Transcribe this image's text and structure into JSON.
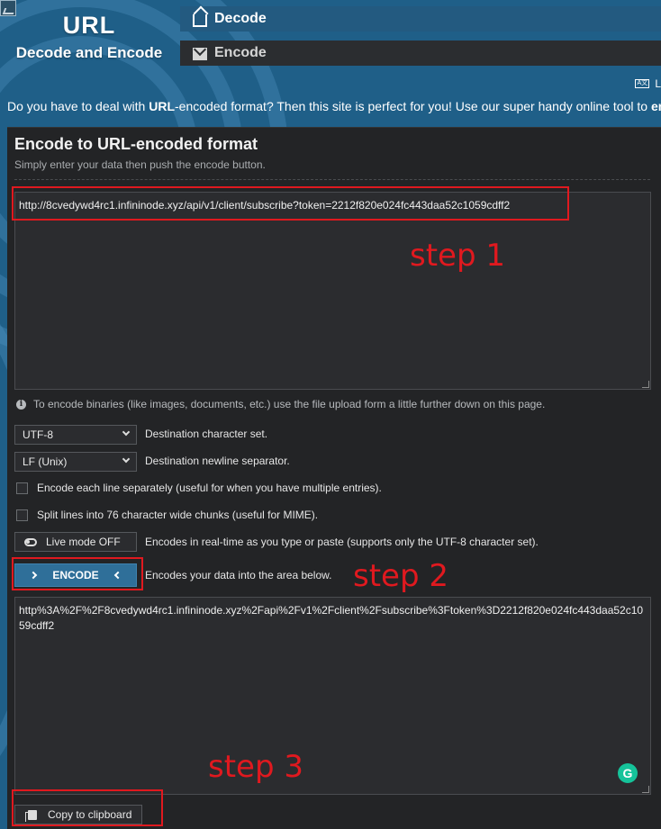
{
  "brand": {
    "title": "URL",
    "subtitle": "Decode and Encode"
  },
  "nav": {
    "decode": "Decode",
    "encode": "Encode"
  },
  "language": {
    "label": "L"
  },
  "intro": {
    "part1": "Do you have to deal with ",
    "bold1": "URL",
    "part2": "-encoded format? Then this site is perfect for you! Use our super handy online tool to ",
    "bold2": "en"
  },
  "panel": {
    "title": "Encode to URL-encoded format",
    "subtitle": "Simply enter your data then push the encode button."
  },
  "input": {
    "value": "http://8cvedywd4rc1.infininode.xyz/api/v1/client/subscribe?token=2212f820e024fc443daa52c1059cdff2"
  },
  "info_text": "To encode binaries (like images, documents, etc.) use the file upload form a little further down on this page.",
  "options": {
    "charset": {
      "value": "UTF-8",
      "label": "Destination character set."
    },
    "newline": {
      "value": "LF (Unix)",
      "label": "Destination newline separator."
    },
    "each_line": "Encode each line separately (useful for when you have multiple entries).",
    "split_lines": "Split lines into 76 character wide chunks (useful for MIME).",
    "live_mode": {
      "button": "Live mode OFF",
      "label": "Encodes in real-time as you type or paste (supports only the UTF-8 character set)."
    },
    "encode": {
      "button": "ENCODE",
      "label": "Encodes your data into the area below."
    }
  },
  "output": {
    "value": "http%3A%2F%2F8cvedywd4rc1.infininode.xyz%2Fapi%2Fv1%2Fclient%2Fsubscribe%3Ftoken%3D2212f820e024fc443daa52c1059cdff2"
  },
  "copy_button": "Copy to clipboard",
  "annotations": {
    "step1": "step 1",
    "step2": "step 2",
    "step3": "step 3",
    "color": "#e0191f"
  },
  "colors": {
    "background": "#1f5f88",
    "panel": "#232426",
    "accent": "#2f6f99",
    "grammarly": "#15c39a"
  },
  "icons": [
    "image-icon",
    "envelope-open-icon",
    "envelope-icon",
    "language-icon",
    "info-icon",
    "chevron-down-icon",
    "toggle-icon",
    "chevron-right-icon",
    "chevron-left-icon",
    "clipboard-icon",
    "grammarly-icon"
  ]
}
